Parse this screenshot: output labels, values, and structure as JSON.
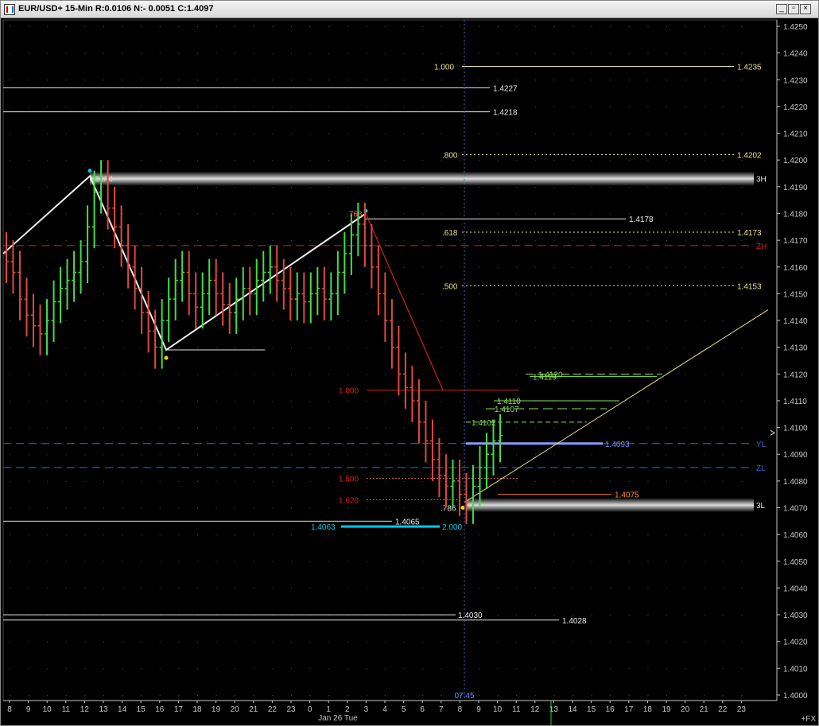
{
  "window": {
    "title": "EUR/USD+ 15-Min R:0.0106 N:- 0.0051 C:1.4097",
    "buttons": [
      "minimize",
      "restore",
      "close"
    ]
  },
  "colors": {
    "background": "#000000",
    "up_bar": "#44dd44",
    "down_bar": "#e04a3a",
    "axis": "#c8c8c8",
    "fib_yellow": "#e8e08c",
    "red_line": "#d02020",
    "blue_line": "#3a6ad0",
    "cyan": "#00c8e8",
    "orange": "#ff8c1a"
  },
  "chart_data": {
    "type": "candlestick",
    "instrument": "EUR/USD+",
    "timeframe": "15-Min",
    "ylim": [
      1.4,
      1.425
    ],
    "y_ticks": [
      "1.4250",
      "1.4240",
      "1.4230",
      "1.4220",
      "1.4210",
      "1.4200",
      "1.4190",
      "1.4180",
      "1.4170",
      "1.4160",
      "1.4150",
      "1.4140",
      "1.4130",
      "1.4120",
      "1.4110",
      "1.4100",
      "1.4090",
      "1.4080",
      "1.4070",
      "1.4060",
      "1.4050",
      "1.4040",
      "1.4030",
      "1.4020",
      "1.4010",
      "1.4000"
    ],
    "x_ticks": [
      "8",
      "9",
      "10",
      "11",
      "12",
      "13",
      "14",
      "15",
      "16",
      "17",
      "18",
      "19",
      "20",
      "21",
      "22",
      "23",
      "0",
      "1",
      "2",
      "3",
      "4",
      "5",
      "6",
      "7",
      "8",
      "9",
      "10",
      "11",
      "12",
      "13",
      "14",
      "15",
      "16",
      "17",
      "18",
      "19",
      "20",
      "21",
      "22",
      "23"
    ],
    "date_label": "Jan 26 Tue",
    "cursor_time": "07:45",
    "corner_label": "+FX",
    "current_price_marker": 1.4098,
    "closes": [
      1.4162,
      1.4158,
      1.4148,
      1.4142,
      1.4138,
      1.4135,
      1.414,
      1.4147,
      1.4152,
      1.4155,
      1.4158,
      1.4162,
      1.4175,
      1.4188,
      1.4192,
      1.4182,
      1.4175,
      1.4168,
      1.416,
      1.4152,
      1.4143,
      1.4136,
      1.413,
      1.414,
      1.4148,
      1.4155,
      1.4158,
      1.415,
      1.4145,
      1.415,
      1.4155,
      1.415,
      1.4146,
      1.4143,
      1.4148,
      1.4152,
      1.415,
      1.4155,
      1.4158,
      1.416,
      1.4155,
      1.4152,
      1.4148,
      1.415,
      1.4147,
      1.415,
      1.4152,
      1.4148,
      1.415,
      1.4158,
      1.4165,
      1.4172,
      1.4176,
      1.4168,
      1.416,
      1.415,
      1.414,
      1.413,
      1.412,
      1.4115,
      1.411,
      1.4102,
      1.4095,
      1.4088,
      1.4082,
      1.4078,
      1.408,
      1.4075,
      1.4072,
      1.4078,
      1.4085,
      1.409,
      1.4095,
      1.4097
    ],
    "drawn_levels": [
      {
        "label": "1.4235",
        "color": "yellow"
      },
      {
        "label": "1.4227",
        "color": "white"
      },
      {
        "label": "1.4218",
        "color": "white"
      },
      {
        "label": "1.4202",
        "color": "yellow"
      },
      {
        "label": "1.4178",
        "color": "white"
      },
      {
        "label": "1.4173",
        "color": "yellow"
      },
      {
        "label": "1.4153",
        "color": "yellow"
      },
      {
        "label": "1.4120",
        "color": "green"
      },
      {
        "label": "1.4119",
        "color": "green"
      },
      {
        "label": "1.4110",
        "color": "green"
      },
      {
        "label": "1.4107",
        "color": "green"
      },
      {
        "label": "1.4102",
        "color": "green"
      },
      {
        "label": "1.4093",
        "color": "blue"
      },
      {
        "label": "1.4075",
        "color": "orange"
      },
      {
        "label": "1.4065",
        "color": "white"
      },
      {
        "label": "1.4063",
        "color": "cyan"
      },
      {
        "label": "1.4030",
        "color": "white"
      },
      {
        "label": "1.4028",
        "color": "white"
      }
    ],
    "fib_ratios": [
      {
        "label": "1.000",
        "value": 1.4235,
        "color": "yellow"
      },
      {
        "label": ".800",
        "value": 1.4202,
        "color": "yellow"
      },
      {
        "label": ".618",
        "value": 1.4173,
        "color": "yellow"
      },
      {
        "label": ".500",
        "value": 1.4153,
        "color": "yellow"
      },
      {
        "label": "1.000",
        "value": 1.4114,
        "color": "red"
      },
      {
        "label": "1.500",
        "value": 1.4081,
        "color": "red"
      },
      {
        "label": "1.620",
        "value": 1.4073,
        "color": "red"
      },
      {
        "label": "2.000",
        "value": 1.4063,
        "color": "cyan"
      }
    ],
    "swing_labels": [
      ".6184",
      ".768",
      ".786"
    ],
    "zones": [
      {
        "label": "3H",
        "value": 1.4193
      },
      {
        "label": "ZH",
        "value": 1.4168
      },
      {
        "label": "YL",
        "value": 1.4094
      },
      {
        "label": "ZL",
        "value": 1.4085
      },
      {
        "label": "3L",
        "value": 1.4071
      }
    ]
  }
}
